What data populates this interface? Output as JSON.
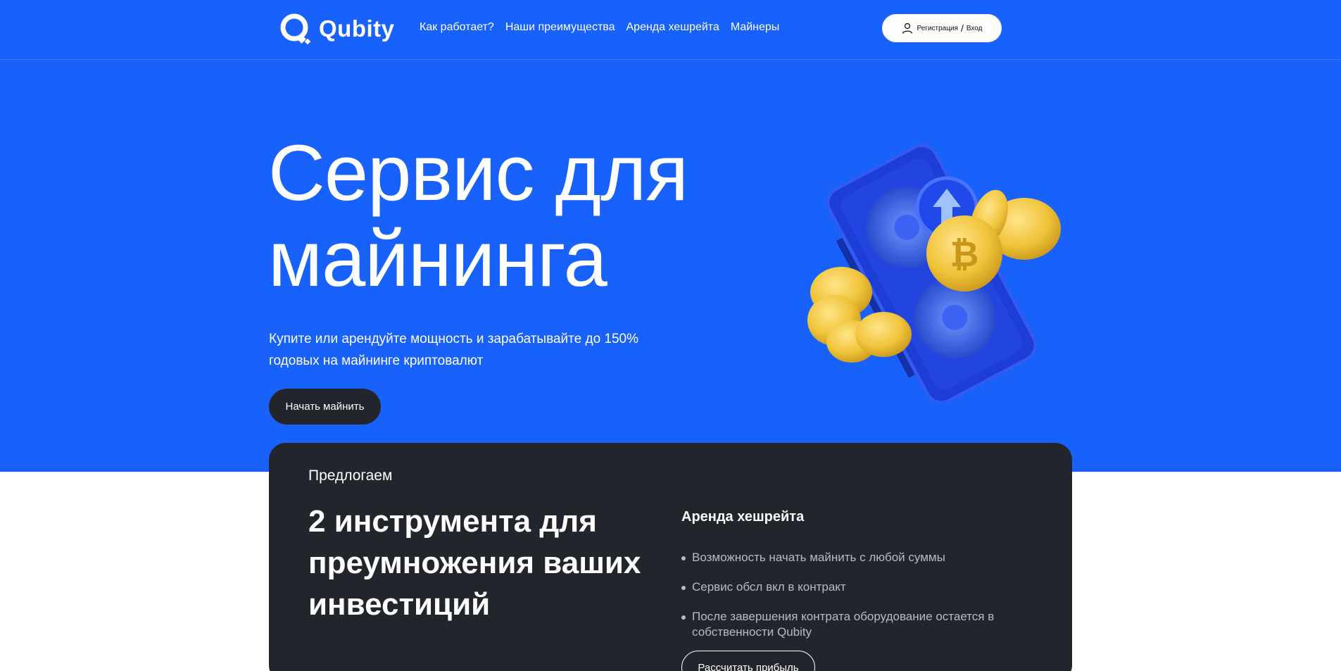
{
  "brand": {
    "name": "Qubity"
  },
  "nav": {
    "items": [
      {
        "label": "Как работает?"
      },
      {
        "label": "Наши преимущества"
      },
      {
        "label": "Аренда хешрейта"
      },
      {
        "label": "Майнеры"
      }
    ],
    "auth": {
      "icon": "user-icon",
      "register": "Регистрация",
      "separator": "/",
      "login": "Вход"
    }
  },
  "hero": {
    "title_line1": "Сервис для",
    "title_line2": "майнинга",
    "subtitle_line1": "Купите или арендуйте мощность и зарабатывайте до 150%",
    "subtitle_line2": "годовых на майнинге криптовалют",
    "cta": "Начать майнить",
    "image": "gpu-with-bitcoins-illustration"
  },
  "offer": {
    "eyebrow": "Предлогаем",
    "title_line1": "2 инструмента для",
    "title_line2": "преумножения ваших",
    "title_line3": "инвестиций",
    "tool_title": "Аренда хешрейта",
    "features": [
      "Возможность начать майнить с любой суммы",
      "Сервис обсл вкл в контракт",
      "После завершения контрата оборудование остается в собственности Qubity"
    ],
    "cta": "Рассчитать прибыль"
  },
  "colors": {
    "hero_bg": "#1862fb",
    "card_bg": "#23252c",
    "coin": "#f0c43a",
    "text_muted": "#b8bbc4"
  }
}
